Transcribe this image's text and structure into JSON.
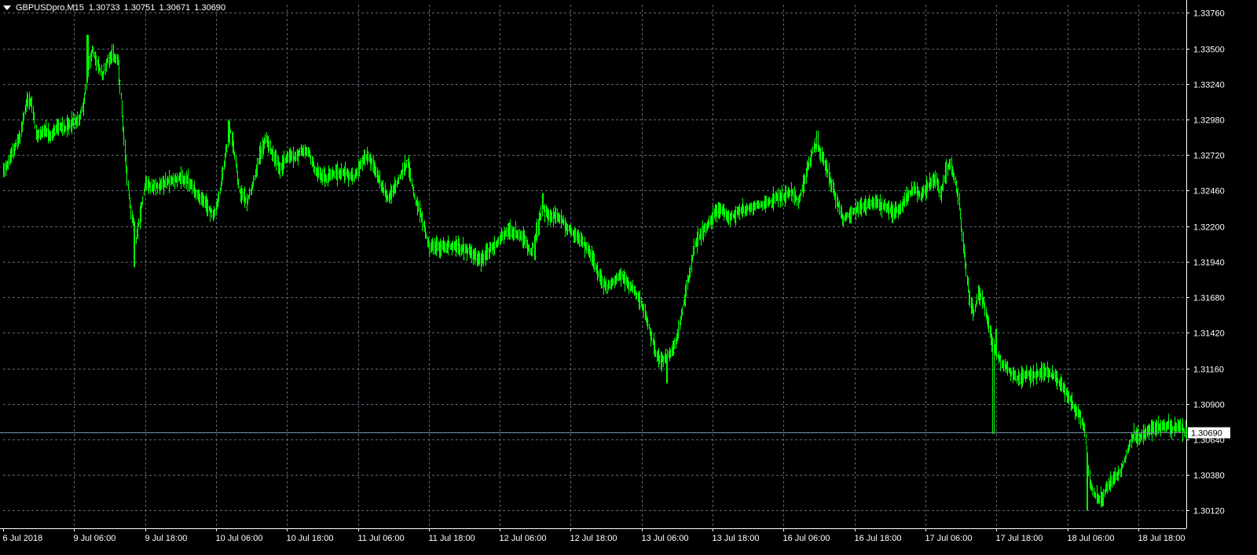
{
  "header": {
    "symbol": "GBPUSDpro,M15",
    "open": "1.30733",
    "high": "1.30751",
    "low": "1.30671",
    "close": "1.30690"
  },
  "colors": {
    "background": "#000000",
    "grid": "#5a6878",
    "axis": "#ffffff",
    "candle": "#00ff00",
    "price_line": "#7a93a8",
    "price_tag_bg": "#ffffff"
  },
  "current_price": {
    "value": 1.3069,
    "label": "1.30690"
  },
  "chart_data": {
    "type": "bar",
    "title": "",
    "grid": true,
    "ylim": [
      1.2999,
      1.3382
    ],
    "y_ticks": [
      "1.33760",
      "1.33500",
      "1.33240",
      "1.32980",
      "1.32720",
      "1.32460",
      "1.32200",
      "1.31940",
      "1.31680",
      "1.31420",
      "1.31160",
      "1.30900",
      "1.30640",
      "1.30380",
      "1.30120"
    ],
    "x_ticks": [
      "6 Jul 2018",
      "9 Jul 06:00",
      "9 Jul 18:00",
      "10 Jul 06:00",
      "10 Jul 18:00",
      "11 Jul 06:00",
      "11 Jul 18:00",
      "12 Jul 06:00",
      "12 Jul 18:00",
      "13 Jul 06:00",
      "13 Jul 18:00",
      "16 Jul 06:00",
      "16 Jul 18:00",
      "17 Jul 06:00",
      "17 Jul 18:00",
      "18 Jul 06:00",
      "18 Jul 18:00"
    ],
    "anchors": [
      [
        0,
        1.3262
      ],
      [
        0.004,
        1.3266
      ],
      [
        0.01,
        1.3279
      ],
      [
        0.014,
        1.3285
      ],
      [
        0.02,
        1.3312
      ],
      [
        0.024,
        1.331
      ],
      [
        0.028,
        1.3285
      ],
      [
        0.034,
        1.329
      ],
      [
        0.04,
        1.3285
      ],
      [
        0.046,
        1.3293
      ],
      [
        0.052,
        1.3292
      ],
      [
        0.058,
        1.3296
      ],
      [
        0.064,
        1.3298
      ],
      [
        0.068,
        1.331
      ],
      [
        0.072,
        1.3336
      ],
      [
        0.075,
        1.3349
      ],
      [
        0.08,
        1.3337
      ],
      [
        0.084,
        1.333
      ],
      [
        0.088,
        1.3342
      ],
      [
        0.092,
        1.3346
      ],
      [
        0.097,
        1.334
      ],
      [
        0.1,
        1.3308
      ],
      [
        0.104,
        1.326
      ],
      [
        0.108,
        1.323
      ],
      [
        0.112,
        1.321
      ],
      [
        0.116,
        1.323
      ],
      [
        0.12,
        1.3252
      ],
      [
        0.126,
        1.3248
      ],
      [
        0.132,
        1.325
      ],
      [
        0.14,
        1.3253
      ],
      [
        0.148,
        1.3255
      ],
      [
        0.156,
        1.3253
      ],
      [
        0.164,
        1.3243
      ],
      [
        0.172,
        1.3235
      ],
      [
        0.178,
        1.3228
      ],
      [
        0.182,
        1.324
      ],
      [
        0.188,
        1.3275
      ],
      [
        0.192,
        1.329
      ],
      [
        0.196,
        1.327
      ],
      [
        0.2,
        1.3245
      ],
      [
        0.206,
        1.3238
      ],
      [
        0.212,
        1.3255
      ],
      [
        0.216,
        1.327
      ],
      [
        0.222,
        1.3285
      ],
      [
        0.228,
        1.3272
      ],
      [
        0.234,
        1.3262
      ],
      [
        0.24,
        1.3272
      ],
      [
        0.246,
        1.327
      ],
      [
        0.252,
        1.3275
      ],
      [
        0.258,
        1.3274
      ],
      [
        0.264,
        1.326
      ],
      [
        0.272,
        1.3255
      ],
      [
        0.28,
        1.3258
      ],
      [
        0.288,
        1.326
      ],
      [
        0.296,
        1.3255
      ],
      [
        0.302,
        1.3266
      ],
      [
        0.308,
        1.3272
      ],
      [
        0.314,
        1.3262
      ],
      [
        0.32,
        1.3248
      ],
      [
        0.326,
        1.324
      ],
      [
        0.332,
        1.325
      ],
      [
        0.338,
        1.3262
      ],
      [
        0.342,
        1.3266
      ],
      [
        0.348,
        1.324
      ],
      [
        0.354,
        1.3225
      ],
      [
        0.36,
        1.3205
      ],
      [
        0.368,
        1.3205
      ],
      [
        0.376,
        1.3206
      ],
      [
        0.384,
        1.3205
      ],
      [
        0.392,
        1.3203
      ],
      [
        0.398,
        1.3198
      ],
      [
        0.404,
        1.3195
      ],
      [
        0.41,
        1.3202
      ],
      [
        0.416,
        1.3206
      ],
      [
        0.422,
        1.3213
      ],
      [
        0.428,
        1.3217
      ],
      [
        0.434,
        1.3214
      ],
      [
        0.44,
        1.3212
      ],
      [
        0.446,
        1.32
      ],
      [
        0.452,
        1.322
      ],
      [
        0.456,
        1.3235
      ],
      [
        0.462,
        1.3226
      ],
      [
        0.468,
        1.3228
      ],
      [
        0.474,
        1.3222
      ],
      [
        0.48,
        1.3215
      ],
      [
        0.486,
        1.3212
      ],
      [
        0.492,
        1.3205
      ],
      [
        0.498,
        1.3196
      ],
      [
        0.504,
        1.3182
      ],
      [
        0.51,
        1.3175
      ],
      [
        0.516,
        1.318
      ],
      [
        0.522,
        1.3185
      ],
      [
        0.528,
        1.3178
      ],
      [
        0.534,
        1.3172
      ],
      [
        0.54,
        1.3162
      ],
      [
        0.546,
        1.3145
      ],
      [
        0.552,
        1.3125
      ],
      [
        0.558,
        1.3122
      ],
      [
        0.564,
        1.3128
      ],
      [
        0.568,
        1.3135
      ],
      [
        0.572,
        1.315
      ],
      [
        0.576,
        1.3168
      ],
      [
        0.58,
        1.3185
      ],
      [
        0.584,
        1.3205
      ],
      [
        0.59,
        1.3215
      ],
      [
        0.596,
        1.3222
      ],
      [
        0.602,
        1.323
      ],
      [
        0.608,
        1.3232
      ],
      [
        0.614,
        1.3226
      ],
      [
        0.62,
        1.323
      ],
      [
        0.628,
        1.3232
      ],
      [
        0.636,
        1.3235
      ],
      [
        0.644,
        1.3236
      ],
      [
        0.652,
        1.324
      ],
      [
        0.66,
        1.3242
      ],
      [
        0.666,
        1.3245
      ],
      [
        0.672,
        1.3238
      ],
      [
        0.676,
        1.325
      ],
      [
        0.68,
        1.3262
      ],
      [
        0.684,
        1.3275
      ],
      [
        0.688,
        1.328
      ],
      [
        0.692,
        1.327
      ],
      [
        0.696,
        1.3262
      ],
      [
        0.7,
        1.325
      ],
      [
        0.704,
        1.324
      ],
      [
        0.71,
        1.3225
      ],
      [
        0.716,
        1.323
      ],
      [
        0.722,
        1.3233
      ],
      [
        0.73,
        1.3236
      ],
      [
        0.738,
        1.3237
      ],
      [
        0.746,
        1.3234
      ],
      [
        0.752,
        1.323
      ],
      [
        0.758,
        1.3232
      ],
      [
        0.764,
        1.3242
      ],
      [
        0.77,
        1.3247
      ],
      [
        0.776,
        1.3242
      ],
      [
        0.782,
        1.325
      ],
      [
        0.788,
        1.3255
      ],
      [
        0.792,
        1.3242
      ],
      [
        0.796,
        1.3258
      ],
      [
        0.8,
        1.3266
      ],
      [
        0.804,
        1.3255
      ],
      [
        0.808,
        1.3235
      ],
      [
        0.812,
        1.32
      ],
      [
        0.816,
        1.317
      ],
      [
        0.82,
        1.3155
      ],
      [
        0.824,
        1.3172
      ],
      [
        0.828,
        1.3165
      ],
      [
        0.832,
        1.315
      ],
      [
        0.836,
        1.3135
      ],
      [
        0.84,
        1.3125
      ],
      [
        0.846,
        1.3118
      ],
      [
        0.852,
        1.3112
      ],
      [
        0.858,
        1.3108
      ],
      [
        0.864,
        1.3112
      ],
      [
        0.87,
        1.311
      ],
      [
        0.876,
        1.3112
      ],
      [
        0.882,
        1.3114
      ],
      [
        0.888,
        1.311
      ],
      [
        0.894,
        1.3104
      ],
      [
        0.9,
        1.3096
      ],
      [
        0.906,
        1.3085
      ],
      [
        0.91,
        1.3082
      ],
      [
        0.914,
        1.307
      ],
      [
        0.916,
        1.3055
      ],
      [
        0.918,
        1.3032
      ],
      [
        0.922,
        1.3025
      ],
      [
        0.926,
        1.302
      ],
      [
        0.93,
        1.3025
      ],
      [
        0.934,
        1.303
      ],
      [
        0.938,
        1.3035
      ],
      [
        0.944,
        1.304
      ],
      [
        0.948,
        1.305
      ],
      [
        0.952,
        1.306
      ],
      [
        0.956,
        1.3068
      ],
      [
        0.96,
        1.3065
      ],
      [
        0.964,
        1.3068
      ],
      [
        0.968,
        1.307
      ],
      [
        0.972,
        1.3072
      ],
      [
        0.976,
        1.3073
      ],
      [
        0.98,
        1.3073
      ],
      [
        0.984,
        1.3075
      ],
      [
        0.988,
        1.3072
      ],
      [
        0.992,
        1.3073
      ],
      [
        0.996,
        1.3072
      ],
      [
        1,
        1.3069
      ]
    ],
    "spikes": [
      [
        0.111,
        1.319,
        "low"
      ],
      [
        0.071,
        1.336,
        "high"
      ],
      [
        0.19,
        1.3298,
        "high"
      ],
      [
        0.206,
        1.3236,
        "low"
      ],
      [
        0.449,
        1.3195,
        "low"
      ],
      [
        0.456,
        1.3244,
        "high"
      ],
      [
        0.561,
        1.3105,
        "low"
      ],
      [
        0.688,
        1.329,
        "high"
      ],
      [
        0.716,
        1.3222,
        "low"
      ],
      [
        0.8,
        1.3269,
        "high"
      ],
      [
        0.837,
        1.3068,
        "low"
      ],
      [
        0.839,
        1.3145,
        "high"
      ],
      [
        0.916,
        1.3012,
        "low"
      ],
      [
        0.929,
        1.3015,
        "low"
      ]
    ]
  }
}
